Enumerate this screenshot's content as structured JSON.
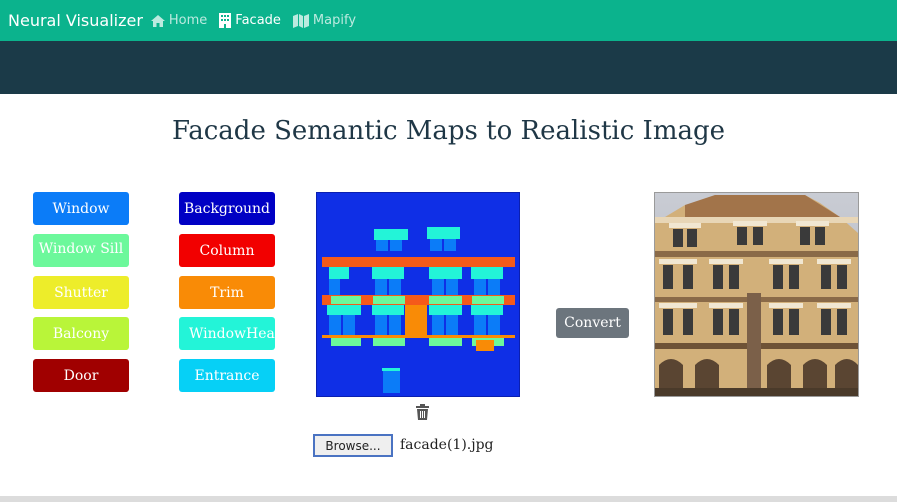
{
  "navbar": {
    "brand": "Neural Visualizer",
    "items": [
      {
        "label": "Home",
        "icon": "home-icon",
        "active": false
      },
      {
        "label": "Facade",
        "icon": "building-icon",
        "active": true
      },
      {
        "label": "Mapify",
        "icon": "map-icon",
        "active": false
      }
    ],
    "color": "#0bb38d"
  },
  "page": {
    "title": "Facade Semantic Maps to Realistic Image"
  },
  "labels": {
    "left": [
      {
        "label": "Window",
        "color": "#0b7cf8"
      },
      {
        "label": "Window Sill",
        "color": "#6cf89b"
      },
      {
        "label": "Shutter",
        "color": "#eded2a"
      },
      {
        "label": "Balcony",
        "color": "#b9f539"
      },
      {
        "label": "Door",
        "color": "#a00000"
      }
    ],
    "right": [
      {
        "label": "Background",
        "color": "#0000c4"
      },
      {
        "label": "Column",
        "color": "#f20000"
      },
      {
        "label": "Trim",
        "color": "#f98b06"
      },
      {
        "label": "WindowHead",
        "color": "#23f4d8"
      },
      {
        "label": "Entrance",
        "color": "#06d0f6"
      }
    ]
  },
  "actions": {
    "convert": "Convert",
    "browse": "Browse...",
    "file_name": "facade(1).jpg"
  },
  "colors": {
    "banner": "#1b3a48",
    "canvas_background": "#0f2fe6",
    "convert_button": "#6c757d"
  }
}
